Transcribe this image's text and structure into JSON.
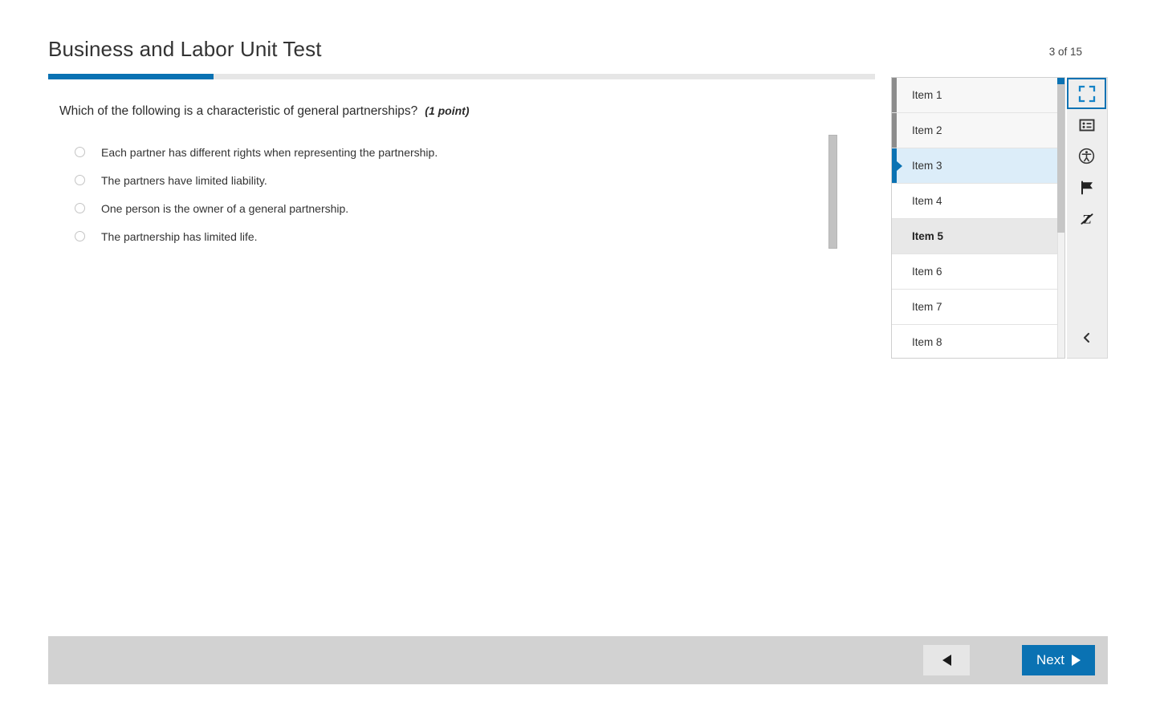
{
  "header": {
    "title": "Business and Labor Unit Test",
    "counter": "3 of 15"
  },
  "progress": {
    "percent": 20,
    "fill_color": "#0a72b3",
    "track_color": "#e6e6e6"
  },
  "question": {
    "stem": "Which of the following is a characteristic of general partnerships?",
    "points": "(1 point)",
    "choices": [
      {
        "label": "Each partner has different rights when representing the partnership.",
        "selected": false
      },
      {
        "label": "The partners have limited liability.",
        "selected": false
      },
      {
        "label": "One person is the owner of a general partnership.",
        "selected": false
      },
      {
        "label": "The partnership has limited life.",
        "selected": false
      }
    ]
  },
  "item_panel": {
    "items": [
      {
        "label": "Item 1",
        "state": "answered"
      },
      {
        "label": "Item 2",
        "state": "answered"
      },
      {
        "label": "Item 3",
        "state": "current"
      },
      {
        "label": "Item 4",
        "state": "normal"
      },
      {
        "label": "Item 5",
        "state": "hovered"
      },
      {
        "label": "Item 6",
        "state": "normal"
      },
      {
        "label": "Item 7",
        "state": "normal"
      },
      {
        "label": "Item 8",
        "state": "normal"
      }
    ]
  },
  "tools": [
    {
      "name": "fullscreen-icon",
      "title": "Full Screen",
      "active": true
    },
    {
      "name": "item-list-icon",
      "title": "Item List",
      "active": false
    },
    {
      "name": "accessibility-icon",
      "title": "Accessibility",
      "active": false
    },
    {
      "name": "flag-icon",
      "title": "Flag Item",
      "active": false
    },
    {
      "name": "strikethrough-icon",
      "title": "Answer Eliminator",
      "active": false
    }
  ],
  "collapse": {
    "name": "chevron-left-icon",
    "title": "Collapse Panel"
  },
  "footer": {
    "prev_label": "",
    "next_label": "Next",
    "next_color": "#0a72b3"
  }
}
